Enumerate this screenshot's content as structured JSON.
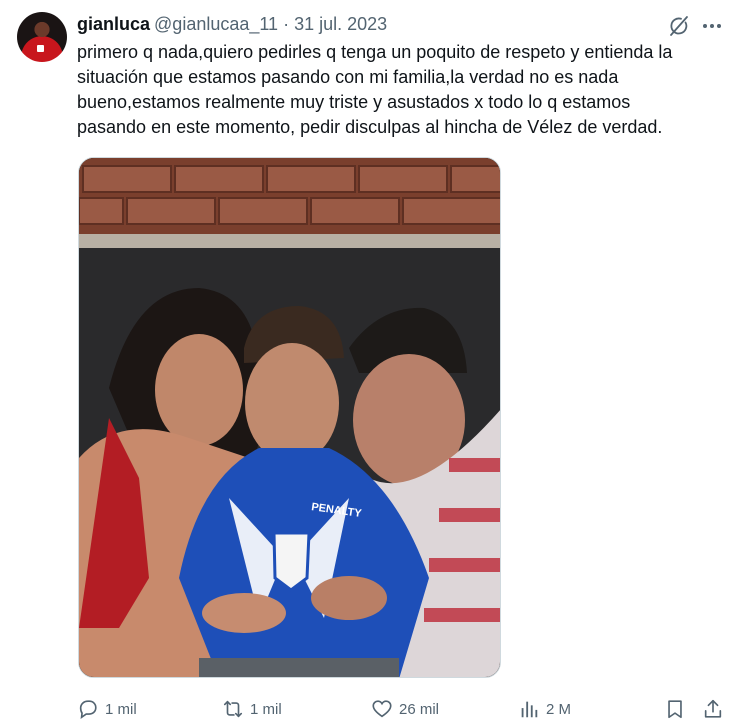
{
  "tweet": {
    "author_name": "gianluca",
    "author_handle": "@gianlucaa_11",
    "separator": "·",
    "date": "31 jul. 2023",
    "text_lines": [
      "primero q nada,quiero pedirles q tenga un poquito de respeto y entienda la",
      "situación que estamos pasando con mi familia,la verdad no es nada",
      "bueno,estamos realmente muy triste y asustados x todo lo q estamos",
      "pasando en este momento, pedir disculpas al hincha de Vélez de verdad."
    ],
    "photo_jersey_text": "PENALTY"
  },
  "actions": {
    "replies": "1 mil",
    "reposts": "1 mil",
    "likes": "26 mil",
    "views": "2 M"
  },
  "icons": {
    "avatar": "avatar",
    "grok": "grok-icon",
    "more": "more-icon",
    "reply": "reply-icon",
    "repost": "repost-icon",
    "like": "heart-icon",
    "views": "views-icon",
    "bookmark": "bookmark-icon",
    "share": "share-icon"
  },
  "colors": {
    "text": "#0f1419",
    "muted": "#536471",
    "border": "#cfd9de"
  }
}
